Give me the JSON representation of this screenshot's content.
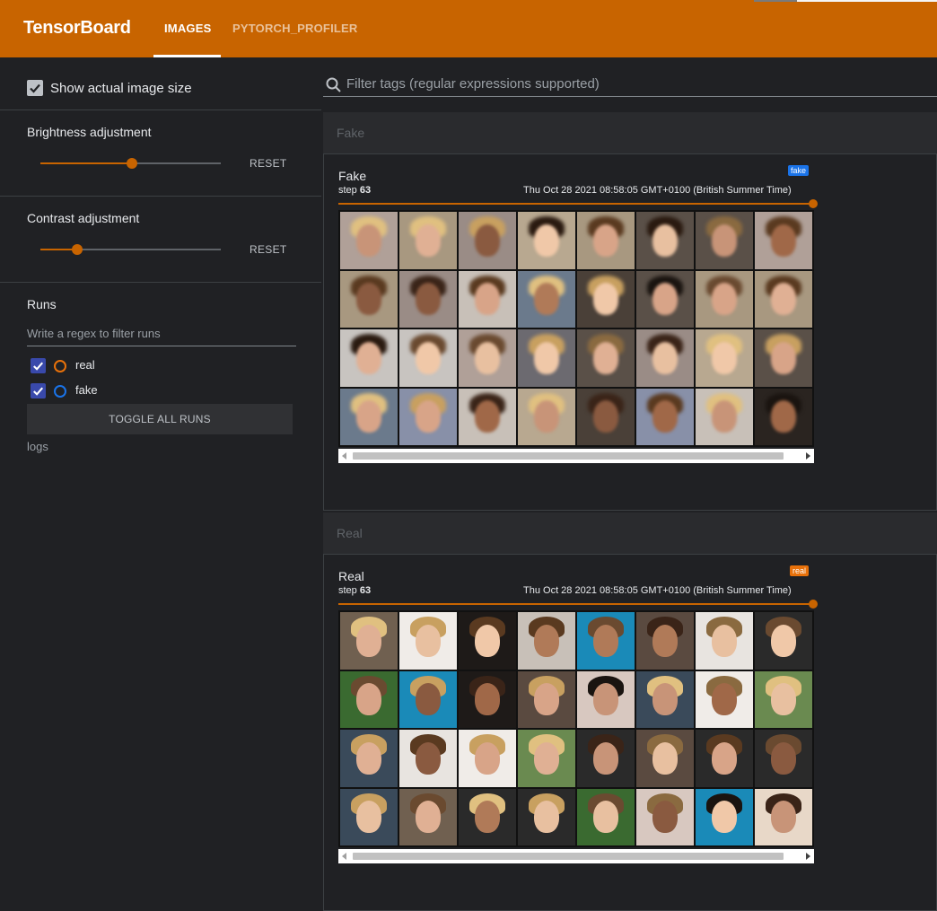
{
  "app": {
    "title": "TensorBoard"
  },
  "tabs": [
    {
      "label": "IMAGES",
      "active": true
    },
    {
      "label": "PYTORCH_PROFILER",
      "active": false
    }
  ],
  "sidebar": {
    "show_actual_size": {
      "label": "Show actual image size",
      "checked": true
    },
    "brightness": {
      "label": "Brightness adjustment",
      "value": 0.5,
      "reset_label": "RESET"
    },
    "contrast": {
      "label": "Contrast adjustment",
      "value": 0.2,
      "reset_label": "RESET"
    },
    "runs": {
      "title": "Runs",
      "filter_placeholder": "Write a regex to filter runs",
      "items": [
        {
          "label": "real",
          "checked": true,
          "color": "#e8710a"
        },
        {
          "label": "fake",
          "checked": true,
          "color": "#1a73e8"
        }
      ],
      "toggle_all_label": "TOGGLE ALL RUNS",
      "logdir": "logs"
    }
  },
  "main": {
    "filter_placeholder": "Filter tags (regular expressions supported)",
    "sections": [
      {
        "title": "Fake",
        "card": {
          "title": "Fake",
          "step_label": "step",
          "step": "63",
          "timestamp": "Thu Oct 28 2021 08:58:05 GMT+0100 (British Summer Time)",
          "badge": "fake",
          "badge_color": "#1a73e8",
          "step_progress": 1.0
        }
      },
      {
        "title": "Real",
        "card": {
          "title": "Real",
          "step_label": "step",
          "step": "63",
          "timestamp": "Thu Oct 28 2021 08:58:05 GMT+0100 (British Summer Time)",
          "badge": "real",
          "badge_color": "#e8710a",
          "step_progress": 1.0
        }
      }
    ]
  },
  "colors": {
    "accent": "#c86400",
    "run_real": "#e8710a",
    "run_fake": "#1a73e8"
  }
}
